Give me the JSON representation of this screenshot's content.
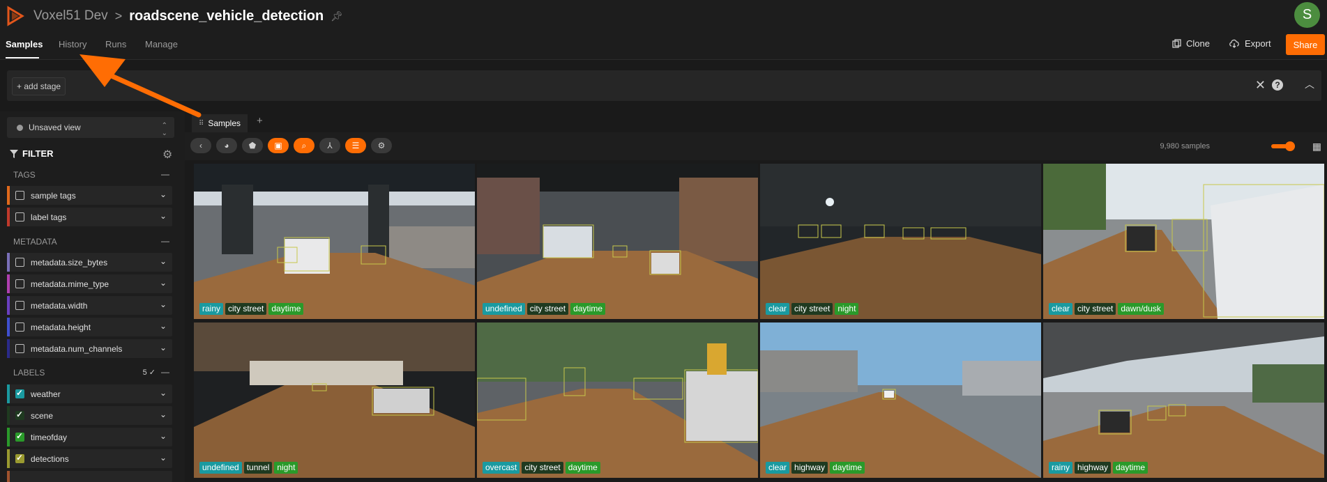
{
  "header": {
    "app_title": "Voxel51 Dev",
    "breadcrumb_sep": ">",
    "dataset_name": "roadscene_vehicle_detection",
    "avatar_letter": "S"
  },
  "nav": {
    "tabs": [
      "Samples",
      "History",
      "Runs",
      "Manage"
    ],
    "clone_label": "Clone",
    "export_label": "Export",
    "share_label": "Share"
  },
  "stage_bar": {
    "add_stage_label": "+ add stage"
  },
  "sidebar": {
    "view_label": "Unsaved view",
    "filter_label": "FILTER",
    "groups": {
      "tags": "TAGS",
      "metadata": "METADATA",
      "labels": "LABELS",
      "labels_count": "5 ✓"
    },
    "tag_fields": [
      "sample tags",
      "label tags"
    ],
    "metadata_fields": [
      "metadata.size_bytes",
      "metadata.mime_type",
      "metadata.width",
      "metadata.height",
      "metadata.num_channels"
    ],
    "label_fields": [
      "weather",
      "scene",
      "timeofday",
      "detections"
    ]
  },
  "colors": {
    "accent": "#ff6d04",
    "stripe_sample_tags": "#e0691b",
    "stripe_label_tags": "#c0392b",
    "stripe_weather": "#1a9aa0",
    "stripe_scene": "#1f3a20",
    "stripe_timeofday": "#2a9a2a",
    "stripe_detections": "#9a9a30"
  },
  "grid": {
    "tab_label": "Samples",
    "sample_count": "9,980 samples",
    "tiles": [
      {
        "weather": "rainy",
        "scene": "city street",
        "time": "daytime"
      },
      {
        "weather": "undefined",
        "scene": "city street",
        "time": "daytime"
      },
      {
        "weather": "clear",
        "scene": "city street",
        "time": "night"
      },
      {
        "weather": "clear",
        "scene": "city street",
        "time": "dawn/dusk"
      },
      {
        "weather": "undefined",
        "scene": "tunnel",
        "time": "night"
      },
      {
        "weather": "overcast",
        "scene": "city street",
        "time": "daytime"
      },
      {
        "weather": "clear",
        "scene": "highway",
        "time": "daytime"
      },
      {
        "weather": "rainy",
        "scene": "highway",
        "time": "daytime"
      }
    ]
  }
}
